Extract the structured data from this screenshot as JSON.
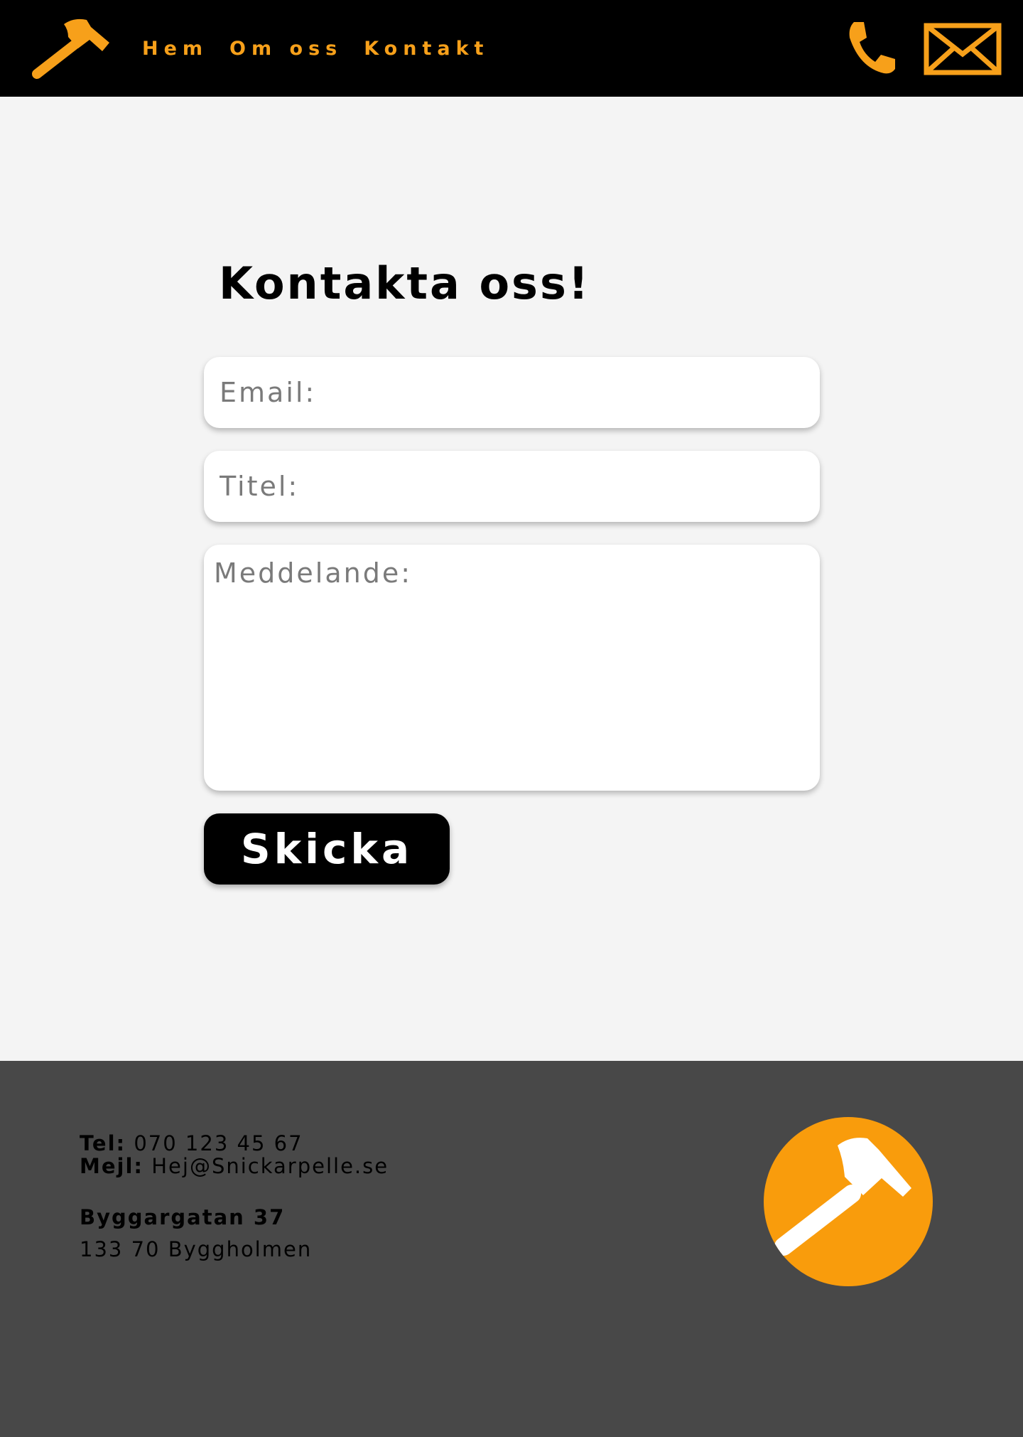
{
  "header": {
    "nav": [
      {
        "label": "Hem"
      },
      {
        "label": "Om oss"
      },
      {
        "label": "Kontakt"
      }
    ],
    "icons": {
      "logo": "hammer-icon",
      "phone": "phone-icon",
      "mail": "mail-icon"
    }
  },
  "main": {
    "title": "Kontakta oss!",
    "form": {
      "email_placeholder": "Email:",
      "title_placeholder": "Titel:",
      "message_placeholder": "Meddelande:",
      "submit_label": "Skicka"
    }
  },
  "footer": {
    "tel_label": "Tel:",
    "tel_value": "070 123 45 67",
    "mail_label": "Mejl:",
    "mail_value": "Hej@Snickarpelle.se",
    "street": "Byggargatan 37",
    "city": "133 70 Byggholmen",
    "logo": "hammer-icon"
  },
  "colors": {
    "accent": "#f7a01a",
    "header_bg": "#000000",
    "page_bg": "#f4f4f4",
    "footer_bg": "#484848",
    "button_bg": "#000000",
    "button_text": "#ffffff"
  }
}
